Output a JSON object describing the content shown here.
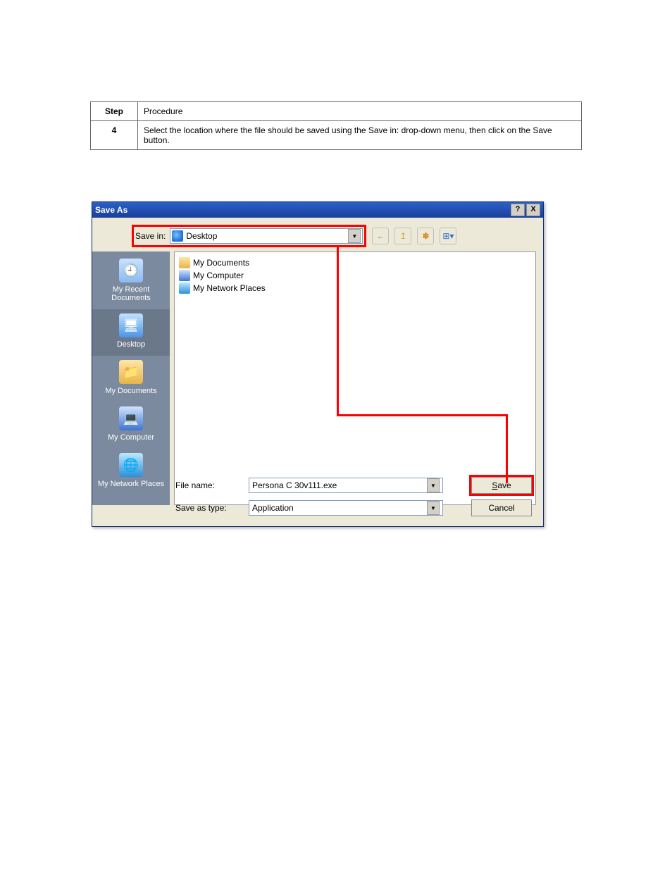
{
  "doc": {
    "step_header": "Step",
    "procedure_header": "Procedure",
    "step_num": "4",
    "step_text": "Select the location where the file should be saved using the Save in: drop-down menu, then click on the Save button."
  },
  "dialog": {
    "title": "Save As",
    "help_btn": "?",
    "close_btn": "X",
    "save_in_label": "Save in:",
    "save_in_value": "Desktop",
    "nav": {
      "back": "←",
      "up": "↥",
      "newfolder": "✽",
      "views": "⊞▾"
    },
    "places": {
      "recent": "My Recent Documents",
      "desktop": "Desktop",
      "documents": "My Documents",
      "computer": "My Computer",
      "network": "My Network Places"
    },
    "files": {
      "f1": "My Documents",
      "f2": "My Computer",
      "f3": "My Network Places"
    },
    "filename_label": "File name:",
    "filename_value": "Persona C 30v111.exe",
    "type_label": "Save as type:",
    "type_value": "Application",
    "save_btn": "Save",
    "cancel_btn": "Cancel"
  }
}
